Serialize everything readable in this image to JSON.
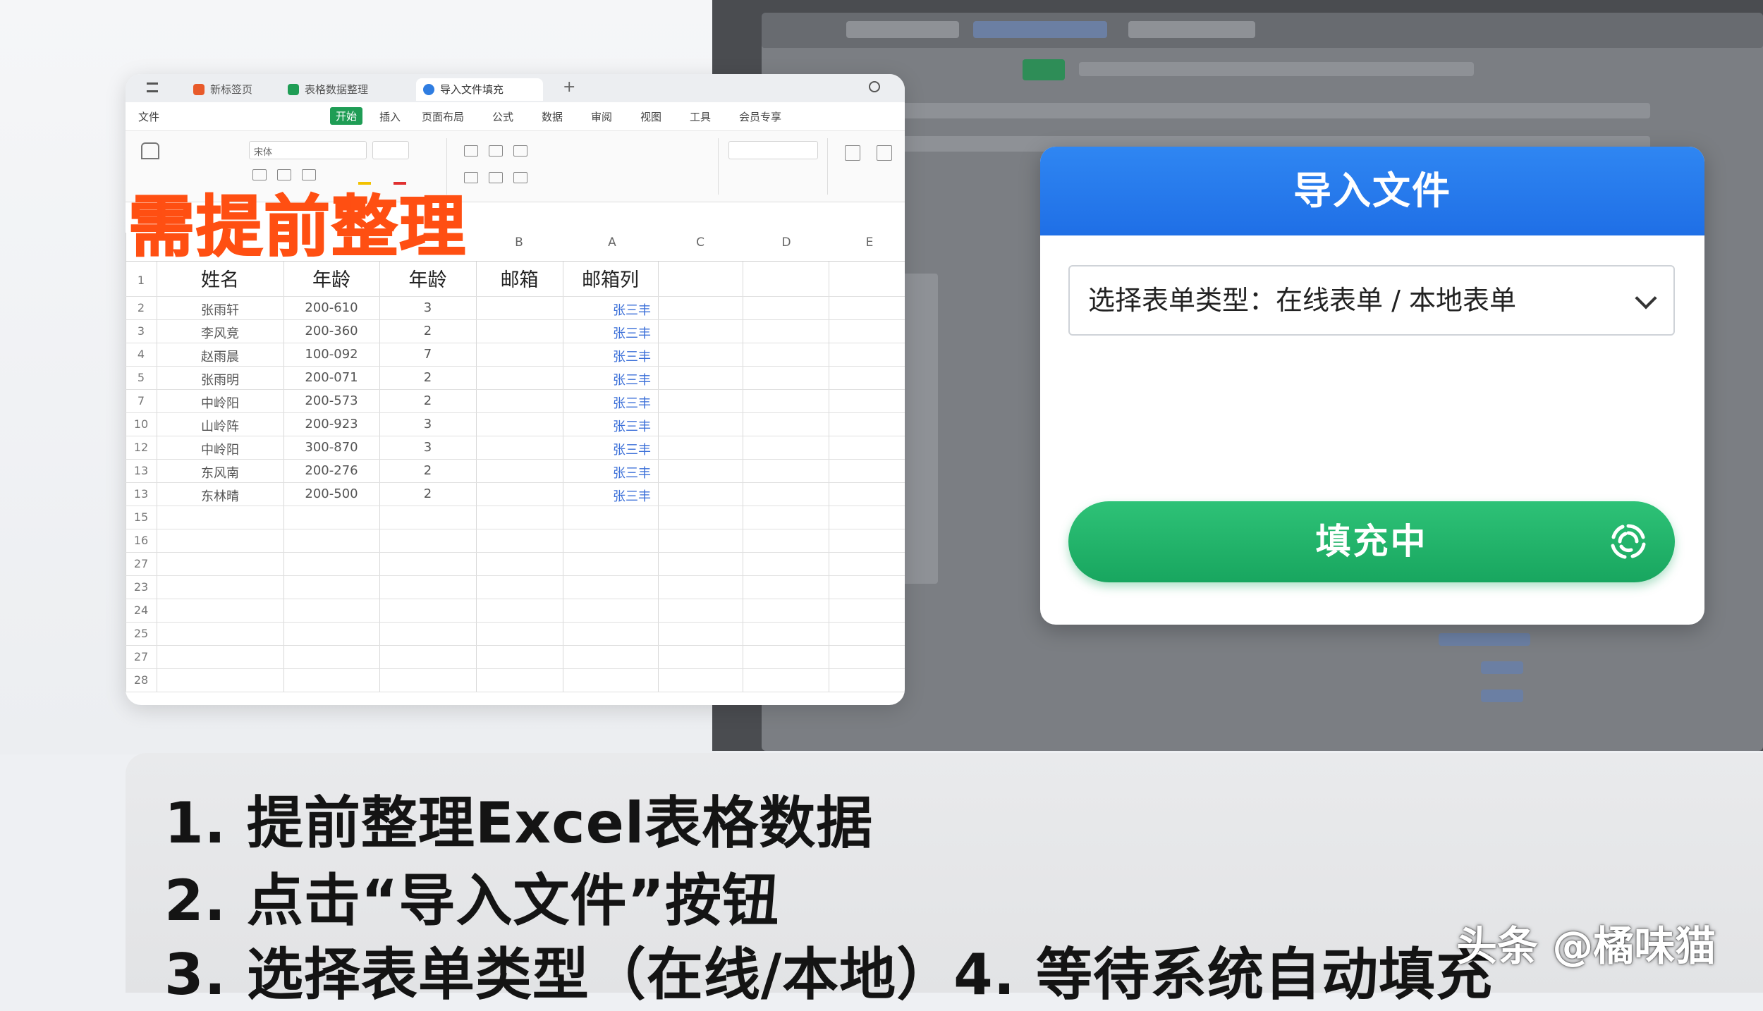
{
  "excel": {
    "tabs": [
      {
        "label": "新标签页",
        "color": "#e85a2a"
      },
      {
        "label": "表格数据整理",
        "color": "#1f9d55"
      },
      {
        "label": "导入文件填充",
        "color": "#2f7de1"
      }
    ],
    "new_tab": "+",
    "menu": [
      "文件",
      "开始",
      "插入",
      "页面布局",
      "公式",
      "数据",
      "审阅",
      "视图",
      "工具",
      "会员专享"
    ],
    "ribbon_font": "宋体",
    "columns": [
      "B",
      "A",
      "C",
      "D",
      "E"
    ],
    "header": [
      "姓名",
      "年龄",
      "年龄",
      "邮箱",
      "邮箱列"
    ],
    "rows": [
      {
        "no": "2",
        "name": "张雨轩",
        "code": "200-610",
        "n": "3",
        "tag": "张三丰"
      },
      {
        "no": "3",
        "name": "李风竞",
        "code": "200-360",
        "n": "2",
        "tag": "张三丰"
      },
      {
        "no": "4",
        "name": "赵雨晨",
        "code": "100-092",
        "n": "7",
        "tag": "张三丰"
      },
      {
        "no": "5",
        "name": "张雨明",
        "code": "200-071",
        "n": "2",
        "tag": "张三丰"
      },
      {
        "no": "7",
        "name": "中岭阳",
        "code": "200-573",
        "n": "2",
        "tag": "张三丰"
      },
      {
        "no": "10",
        "name": "山岭阵",
        "code": "200-923",
        "n": "3",
        "tag": "张三丰"
      },
      {
        "no": "12",
        "name": "中岭阳",
        "code": "300-870",
        "n": "3",
        "tag": "张三丰"
      },
      {
        "no": "13",
        "name": "东风南",
        "code": "200-276",
        "n": "2",
        "tag": "张三丰"
      },
      {
        "no": "13",
        "name": "东林晴",
        "code": "200-500",
        "n": "2",
        "tag": "张三丰"
      }
    ],
    "empty_rows": [
      "15",
      "16",
      "27",
      "23",
      "24",
      "25",
      "27",
      "28"
    ],
    "first_row": "1"
  },
  "overlay_title": "需提前整理",
  "dialog": {
    "title": "导入文件",
    "select_text": "选择表单类型：在线表单 / 本地表单",
    "button_label": "填充中"
  },
  "steps": [
    "1. 提前整理Excel表格数据",
    "2. 点击“导入文件”按钮",
    "3. 选择表单类型（在线/本地）4. 等待系统自动填充"
  ],
  "watermark": "头条 @橘味猫",
  "colors": {
    "accent_blue": "#1f6fe6",
    "button_green": "#18a65f",
    "overlay_orange": "#ff4f12"
  }
}
